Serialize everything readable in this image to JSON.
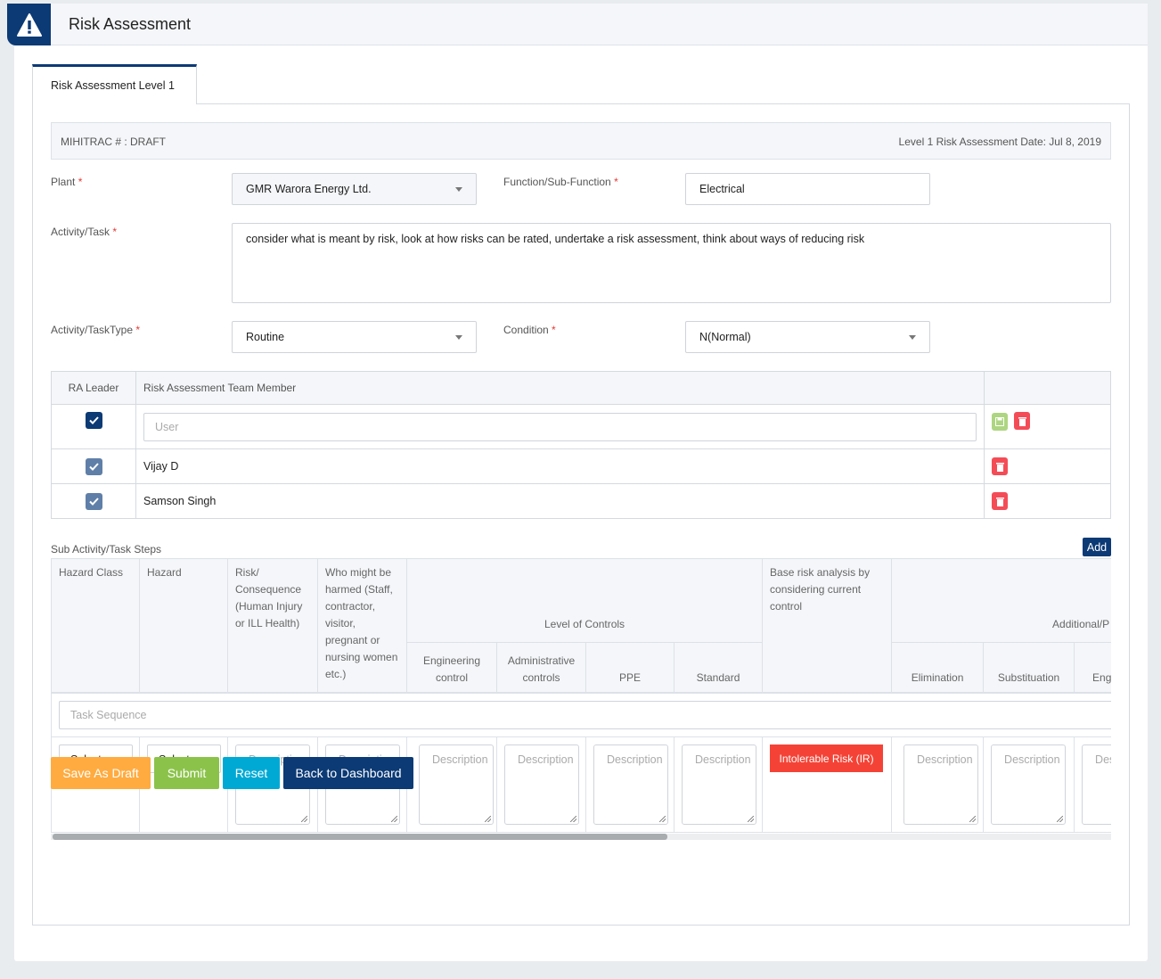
{
  "header": {
    "title": "Risk Assessment",
    "icon": "warning-icon"
  },
  "tabs": [
    {
      "label": "Risk Assessment Level 1",
      "active": true
    }
  ],
  "info": {
    "mihitrac": "MIHITRAC # : DRAFT",
    "date": "Level 1 Risk Assessment Date: Jul 8, 2019"
  },
  "form": {
    "plant": {
      "label": "Plant",
      "value": "GMR Warora Energy Ltd."
    },
    "function": {
      "label": "Function/Sub-Function",
      "value": "Electrical"
    },
    "activity": {
      "label": "Activity/Task",
      "value": "consider what is meant by risk, look at how risks can be rated, undertake a risk assessment, think about ways of reducing risk"
    },
    "type": {
      "label": "Activity/TaskType",
      "value": "Routine"
    },
    "condition": {
      "label": "Condition",
      "value": "N(Normal)"
    },
    "required": "*"
  },
  "team": {
    "headers": [
      "RA Leader",
      "Risk Assessment Team Member"
    ],
    "user_placeholder": "User",
    "members": [
      {
        "name": "Vijay D",
        "leader": true
      },
      {
        "name": "Samson Singh",
        "leader": true
      }
    ]
  },
  "steps": {
    "title": "Sub Activity/Task Steps",
    "add_label": "Add",
    "headers": {
      "hazard_class": "Hazard Class",
      "hazard": "Hazard",
      "risk": "Risk/ Consequence (Human Injury or ILL Health)",
      "who": "Who might be harmed (Staff, contractor, visitor, pregnant or nursing women etc.)",
      "level": "Level of Controls",
      "eng": "Engineering control",
      "admin": "Administrative controls",
      "ppe": "PPE",
      "standard": "Standard",
      "base": "Base risk analysis by considering current control",
      "additional": "Additional/P",
      "elim": "Elimination",
      "subst": "Substituation",
      "eng2": "Engineering control"
    },
    "task_placeholder": "Task Sequence",
    "select_label": "Select",
    "desc_placeholder": "Description",
    "risk_badge": "Intolerable Risk (IR)",
    "scroll_fraction": 0.58
  },
  "actions": {
    "draft": "Save As Draft",
    "submit": "Submit",
    "reset": "Reset",
    "back": "Back to Dashboard"
  },
  "colors": {
    "navy": "#0b3a75",
    "danger": "#f44336",
    "warning": "#ffab40",
    "success": "#8bc34a",
    "info": "#00a9d4"
  }
}
